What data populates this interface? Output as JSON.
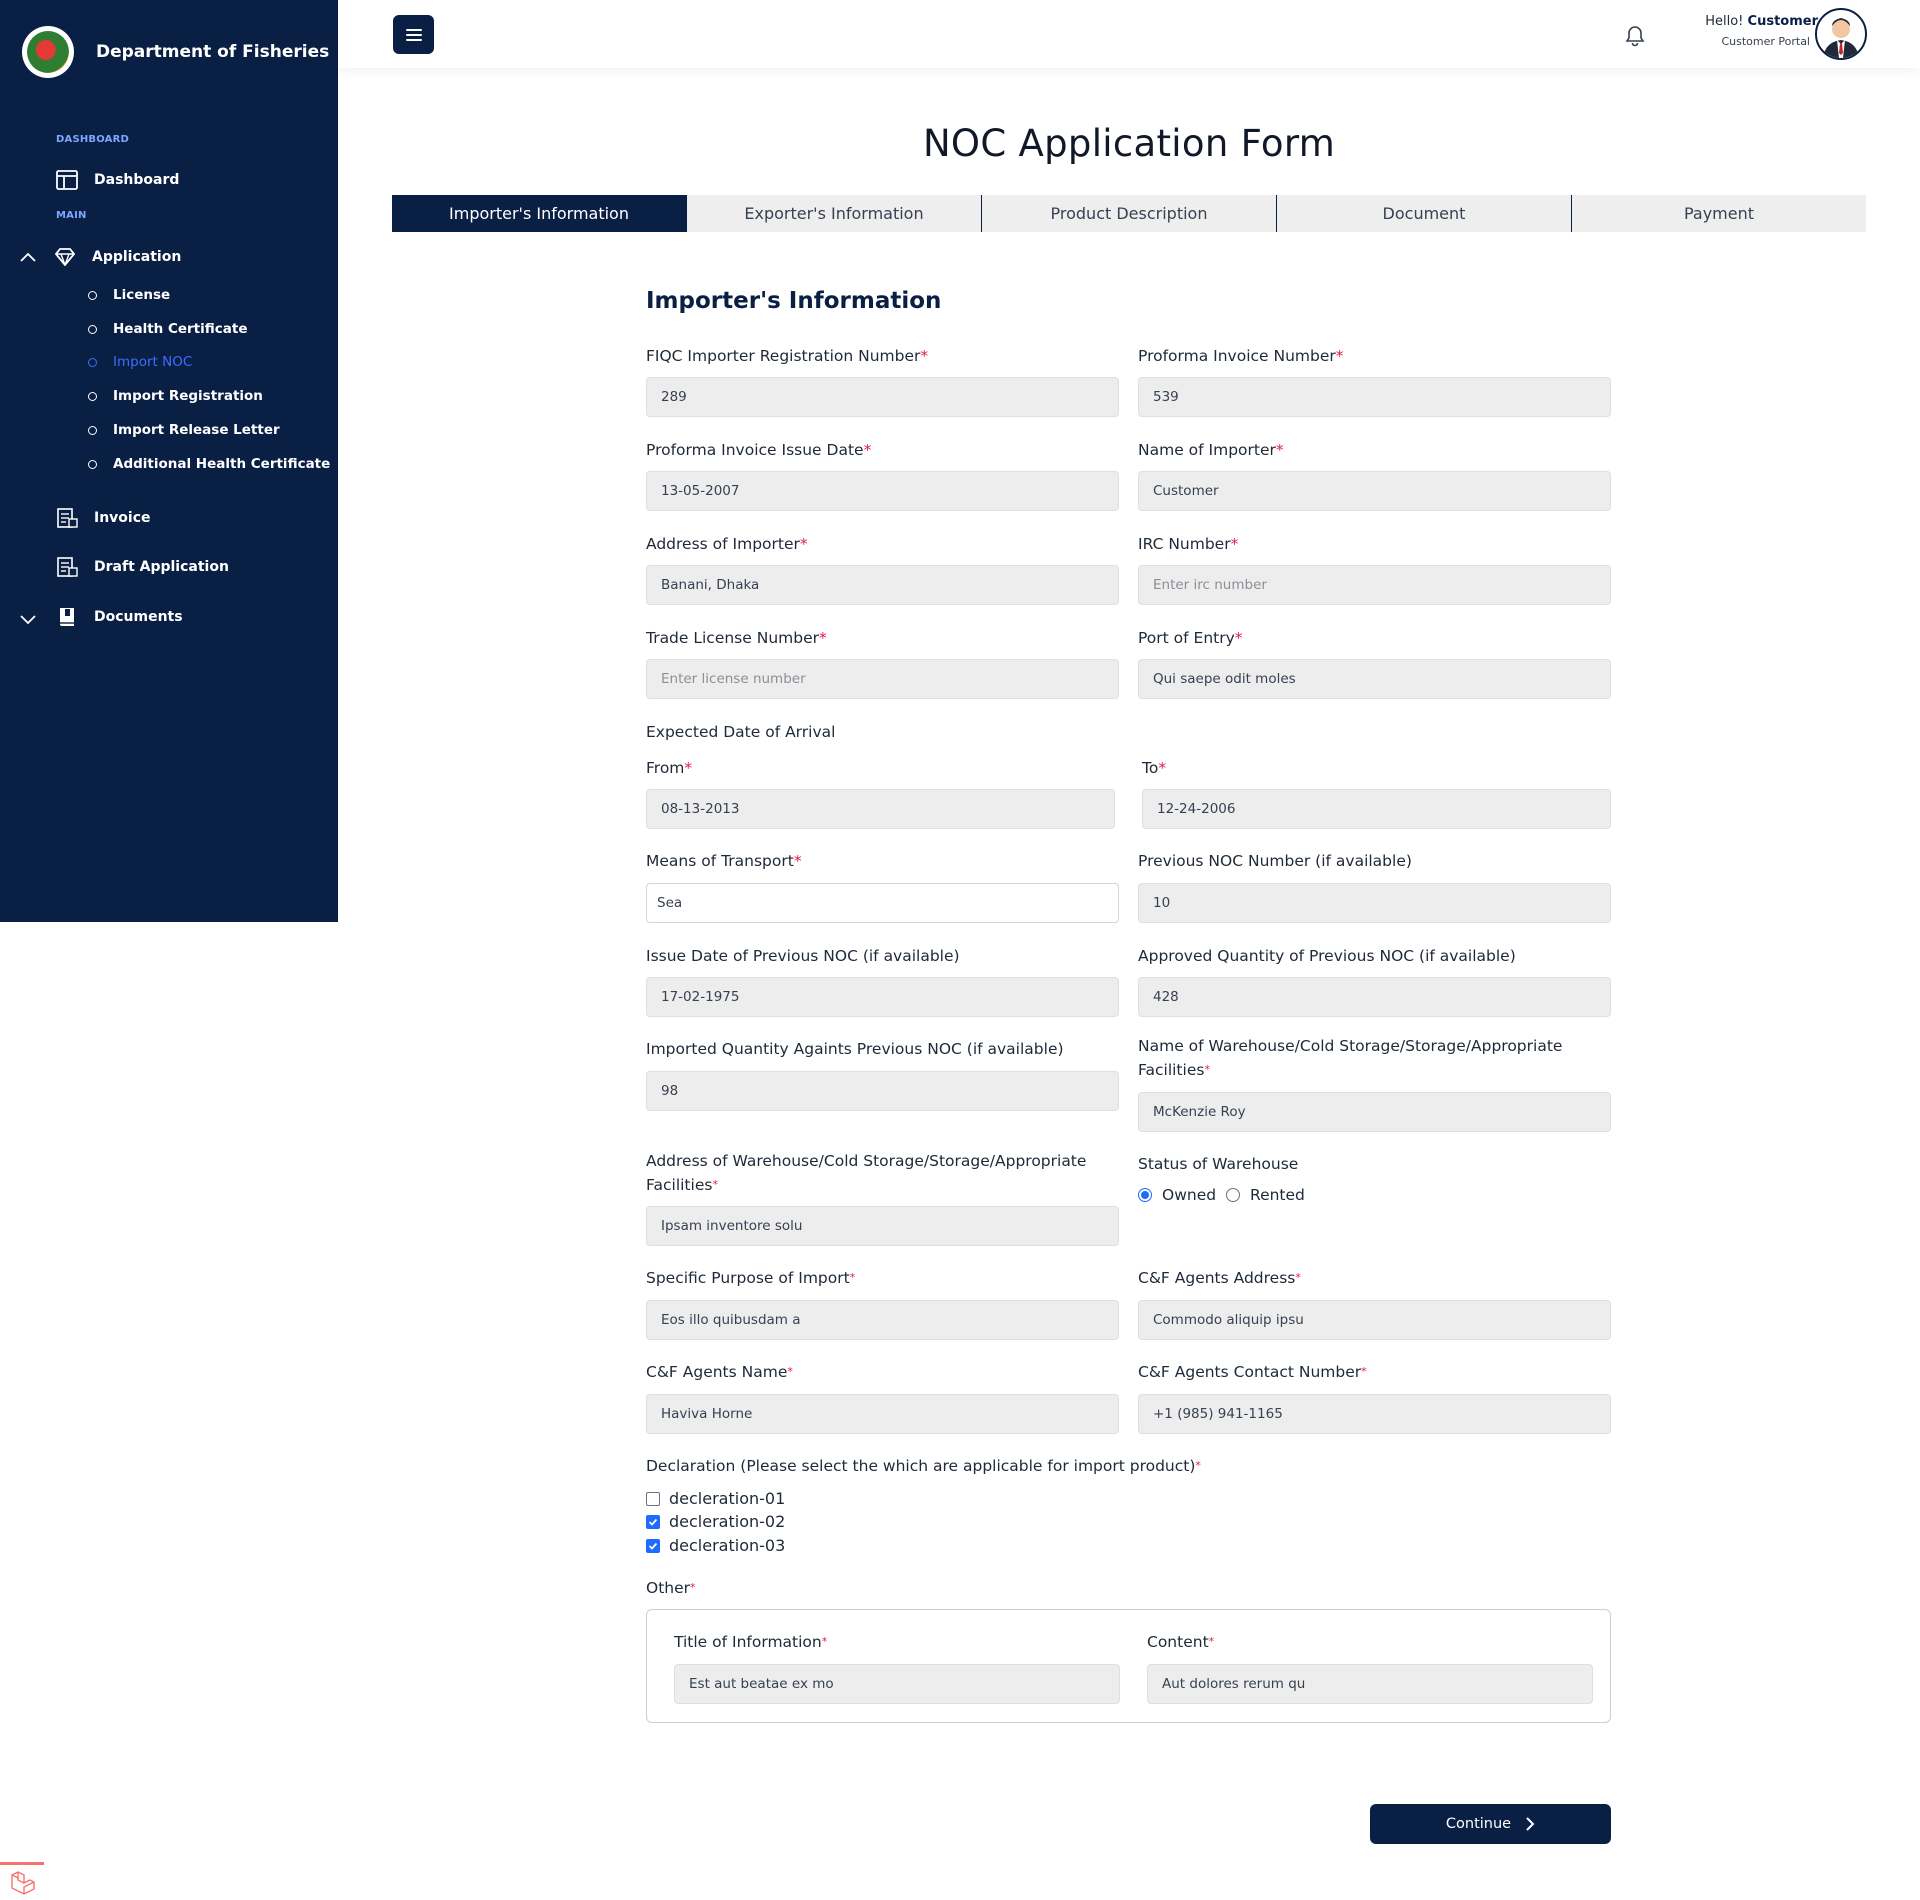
{
  "brand": {
    "name": "Department of Fisheries"
  },
  "sidebar": {
    "section_dashboard": "DASHBOARD",
    "section_main": "MAIN",
    "dashboard": "Dashboard",
    "application": "Application",
    "sub_items": [
      "License",
      "Health Certificate",
      "Import NOC",
      "Import Registration",
      "Import Release Letter",
      "Additional Health Certificate"
    ],
    "active_sub_item": "Import NOC",
    "invoice": "Invoice",
    "draft": "Draft Application",
    "documents": "Documents"
  },
  "header": {
    "greeting": "Hello!",
    "user_name": "Customer",
    "portal": "Customer Portal"
  },
  "page": {
    "title": "NOC Application Form",
    "tabs": [
      "Importer's Information",
      "Exporter's Information",
      "Product Description",
      "Document",
      "Payment"
    ],
    "active_tab": "Importer's Information",
    "section_heading": "Importer's Information"
  },
  "form": {
    "fiqc_label": "FIQC Importer Registration Number",
    "fiqc_value": "289",
    "proforma_no_label": "Proforma Invoice Number",
    "proforma_no_value": "539",
    "proforma_date_label": "Proforma Invoice Issue Date",
    "proforma_date_value": "13-05-2007",
    "importer_name_label": "Name of Importer",
    "importer_name_value": "Customer",
    "importer_address_label": "Address of Importer",
    "importer_address_value": "Banani, Dhaka",
    "irc_label": "IRC Number",
    "irc_placeholder": "Enter irc number",
    "trade_license_label": "Trade License Number",
    "trade_license_placeholder": "Enter license number",
    "port_label": "Port of Entry",
    "port_value": "Qui saepe odit moles",
    "arrival_label": "Expected Date of Arrival",
    "from_label": "From",
    "from_value": "08-13-2013",
    "to_label": "To",
    "to_value": "12-24-2006",
    "transport_label": "Means of Transport",
    "transport_value": "Sea",
    "prev_noc_label": "Previous NOC Number (if available)",
    "prev_noc_value": "10",
    "prev_noc_date_label": "Issue Date of Previous NOC (if available)",
    "prev_noc_date_value": "17-02-1975",
    "approved_qty_label": "Approved Quantity of Previous NOC (if available)",
    "approved_qty_value": "428",
    "imported_qty_label": "Imported Quantity Againts Previous NOC (if available)",
    "imported_qty_value": "98",
    "warehouse_name_label_1": "Name of Warehouse/Cold Storage/Storage/Appropriate",
    "warehouse_name_label_2": "Facilities",
    "warehouse_name_value": "McKenzie Roy",
    "warehouse_address_label_1": "Address of Warehouse/Cold Storage/Storage/Appropriate",
    "warehouse_address_label_2": "Facilities",
    "warehouse_address_value": "Ipsam inventore solu",
    "warehouse_status_label": "Status of Warehouse",
    "status_owned": "Owned",
    "status_rented": "Rented",
    "status_selected": "Owned",
    "purpose_label": "Specific Purpose of Import",
    "purpose_value": "Eos illo quibusdam a",
    "cf_address_label": "C&F Agents Address",
    "cf_address_value": "Commodo aliquip ipsu",
    "cf_name_label": "C&F Agents Name",
    "cf_name_value": "Haviva Horne",
    "cf_contact_label": "C&F Agents Contact Number",
    "cf_contact_value": "+1 (985) 941-1165",
    "declaration_label": "Declaration (Please select the which are applicable for import product)",
    "declarations": [
      {
        "label": "decleration-01",
        "checked": false
      },
      {
        "label": "decleration-02",
        "checked": true
      },
      {
        "label": "decleration-03",
        "checked": true
      }
    ],
    "other_label": "Other",
    "title_info_label": "Title of Information",
    "title_info_value": "Est aut beatae ex mo",
    "content_label": "Content",
    "content_value": "Aut dolores rerum qu",
    "continue_label": "Continue"
  },
  "colors": {
    "primary": "#0a1f44",
    "accent": "#3b6dff",
    "required": "#e11d48",
    "input_bg": "#ededed"
  },
  "icons": [
    "layout-icon",
    "gem-icon",
    "chevron-up-icon",
    "invoice-icon",
    "draft-icon",
    "book-icon",
    "chevron-down-icon",
    "menu-icon",
    "bell-icon",
    "avatar",
    "chevron-right-icon",
    "laravel-logo"
  ]
}
